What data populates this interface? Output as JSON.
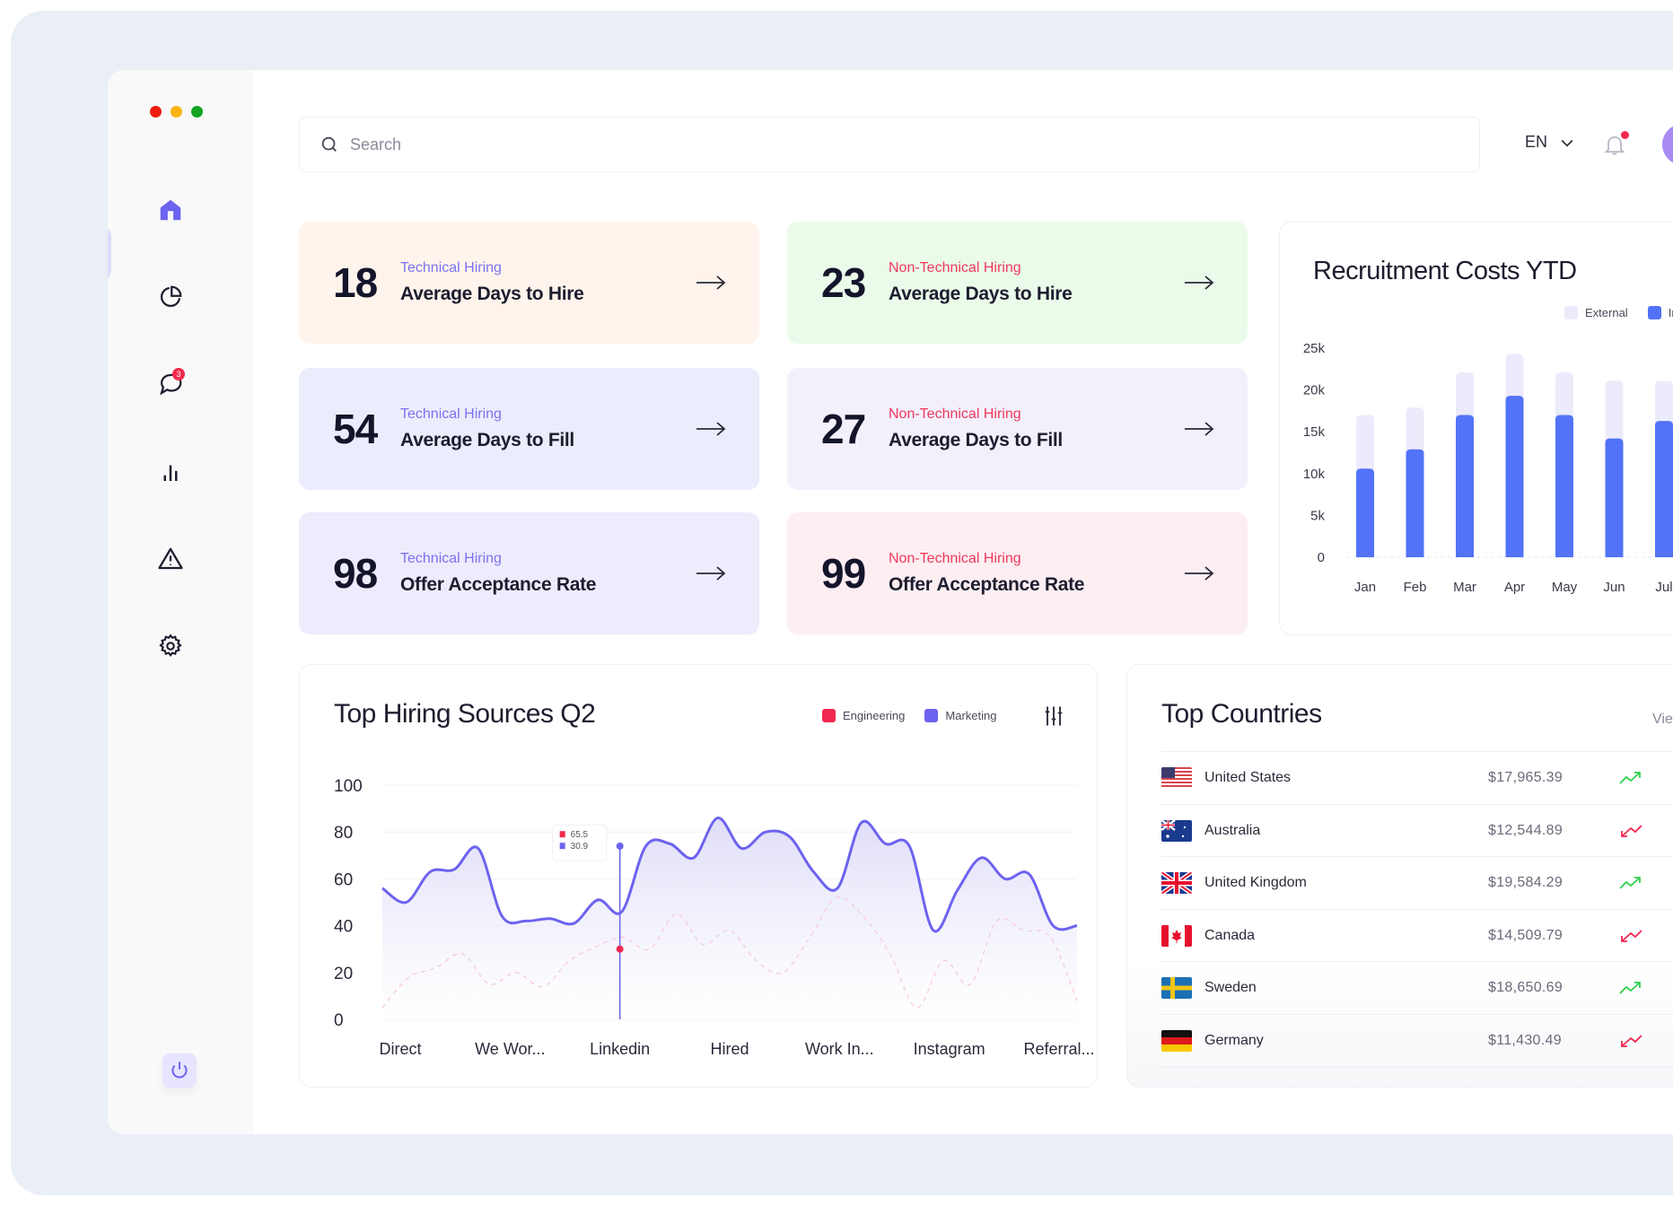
{
  "window": {
    "controls": [
      "close",
      "minimize",
      "maximize"
    ]
  },
  "sidebar": {
    "items": [
      {
        "name": "home",
        "icon": "home-icon",
        "active": true
      },
      {
        "name": "analytics",
        "icon": "pie-chart-icon",
        "active": false
      },
      {
        "name": "messages",
        "icon": "chat-icon",
        "active": false,
        "badge": "3"
      },
      {
        "name": "reports",
        "icon": "bar-chart-icon",
        "active": false
      },
      {
        "name": "alerts",
        "icon": "warning-icon",
        "active": false
      },
      {
        "name": "settings",
        "icon": "gear-icon",
        "active": false
      }
    ],
    "logout_icon": "power-icon"
  },
  "header": {
    "search_placeholder": "Search",
    "language": "EN",
    "notifications_unread": true
  },
  "kpis": [
    {
      "value": "18",
      "category": "Technical Hiring",
      "title": "Average Days to Hire",
      "bg": "#fff4ec",
      "cat_type": "tech"
    },
    {
      "value": "23",
      "category": "Non-Technical Hiring",
      "title": "Average Days to Hire",
      "bg": "#eafbea",
      "cat_type": "nontech"
    },
    {
      "value": "54",
      "category": "Technical Hiring",
      "title": "Average Days to Fill",
      "bg": "#ebedfd",
      "cat_type": "tech"
    },
    {
      "value": "27",
      "category": "Non-Technical Hiring",
      "title": "Average Days to Fill",
      "bg": "#f3f0fc",
      "cat_type": "nontech"
    },
    {
      "value": "98",
      "category": "Technical Hiring",
      "title": "Offer Acceptance Rate",
      "bg": "#eeebfd",
      "cat_type": "tech"
    },
    {
      "value": "99",
      "category": "Non-Technical Hiring",
      "title": "Offer Acceptance Rate",
      "bg": "#fdeef2",
      "cat_type": "nontech"
    }
  ],
  "recruitment_costs": {
    "title": "Recruitment Costs YTD",
    "legend": [
      {
        "label": "External",
        "color": "#ecebfb"
      },
      {
        "label": "In",
        "color": "#5273f8"
      }
    ]
  },
  "hiring_sources": {
    "title": "Top Hiring Sources Q2",
    "legend": [
      {
        "label": "Engineering",
        "color": "#f0284f"
      },
      {
        "label": "Marketing",
        "color": "#6c63f0"
      }
    ],
    "tooltip": {
      "engineering": "65.5",
      "marketing": "30.9"
    }
  },
  "top_countries": {
    "title": "Top Countries",
    "view_link": "Vie",
    "rows": [
      {
        "country": "United States",
        "amount": "$17,965.39",
        "trend": "up",
        "flag": "us"
      },
      {
        "country": "Australia",
        "amount": "$12,544.89",
        "trend": "down",
        "flag": "au"
      },
      {
        "country": "United Kingdom",
        "amount": "$19,584.29",
        "trend": "up",
        "flag": "uk"
      },
      {
        "country": "Canada",
        "amount": "$14,509.79",
        "trend": "down",
        "flag": "ca"
      },
      {
        "country": "Sweden",
        "amount": "$18,650.69",
        "trend": "up",
        "flag": "se"
      },
      {
        "country": "Germany",
        "amount": "$11,430.49",
        "trend": "down",
        "flag": "de"
      }
    ]
  },
  "chart_data": [
    {
      "type": "bar",
      "title": "Recruitment Costs YTD",
      "stacked": true,
      "categories": [
        "Jan",
        "Feb",
        "Mar",
        "Apr",
        "May",
        "Jun",
        "Jul"
      ],
      "series": [
        {
          "name": "In",
          "values": [
            10.6,
            12.9,
            17.0,
            19.3,
            17.0,
            14.2,
            16.3
          ]
        },
        {
          "name": "External",
          "values": [
            6.4,
            5.0,
            5.1,
            5.0,
            5.1,
            6.9,
            4.8
          ]
        }
      ],
      "yticks": [
        "0",
        "5k",
        "10k",
        "15k",
        "20k",
        "25k"
      ],
      "ylim": [
        0,
        25
      ],
      "yunit": "k",
      "xlabel": "",
      "ylabel": "",
      "legend_position": "top-right",
      "grid": false
    },
    {
      "type": "area",
      "title": "Top Hiring Sources Q2",
      "categories": [
        "Direct",
        "We Wor...",
        "Linkedin",
        "Hired",
        "Work In...",
        "Instagram",
        "Referral..."
      ],
      "x": [
        0,
        0.25,
        0.5,
        0.75,
        1,
        1.25,
        1.5,
        1.75,
        2,
        2.25,
        2.5,
        2.75,
        3,
        3.25,
        3.5,
        3.75,
        4,
        4.25,
        4.5,
        4.75,
        5,
        5.25,
        5.5,
        5.75,
        6,
        6.25,
        6.5
      ],
      "series": [
        {
          "name": "Marketing",
          "values": [
            56,
            50,
            63,
            64,
            73,
            44,
            42,
            43,
            41,
            51,
            46,
            74,
            75,
            69,
            86,
            73,
            80,
            78,
            63,
            56,
            84,
            75,
            74,
            38,
            55,
            69,
            60,
            62,
            40,
            40
          ]
        },
        {
          "name": "Engineering",
          "values": [
            5,
            18,
            22,
            28,
            15,
            20,
            14,
            25,
            31,
            35,
            30,
            45,
            32,
            38,
            25,
            20,
            35,
            52,
            44,
            28,
            5,
            25,
            15,
            42,
            38,
            35,
            8
          ]
        }
      ],
      "highlight": {
        "category": "Linkedin",
        "Engineering": 65.5,
        "Marketing": 30.9
      },
      "yticks": [
        "0",
        "20",
        "40",
        "60",
        "80",
        "100"
      ],
      "ylim": [
        0,
        100
      ],
      "xlabel": "",
      "ylabel": "",
      "legend_position": "top-right",
      "grid": true
    }
  ]
}
